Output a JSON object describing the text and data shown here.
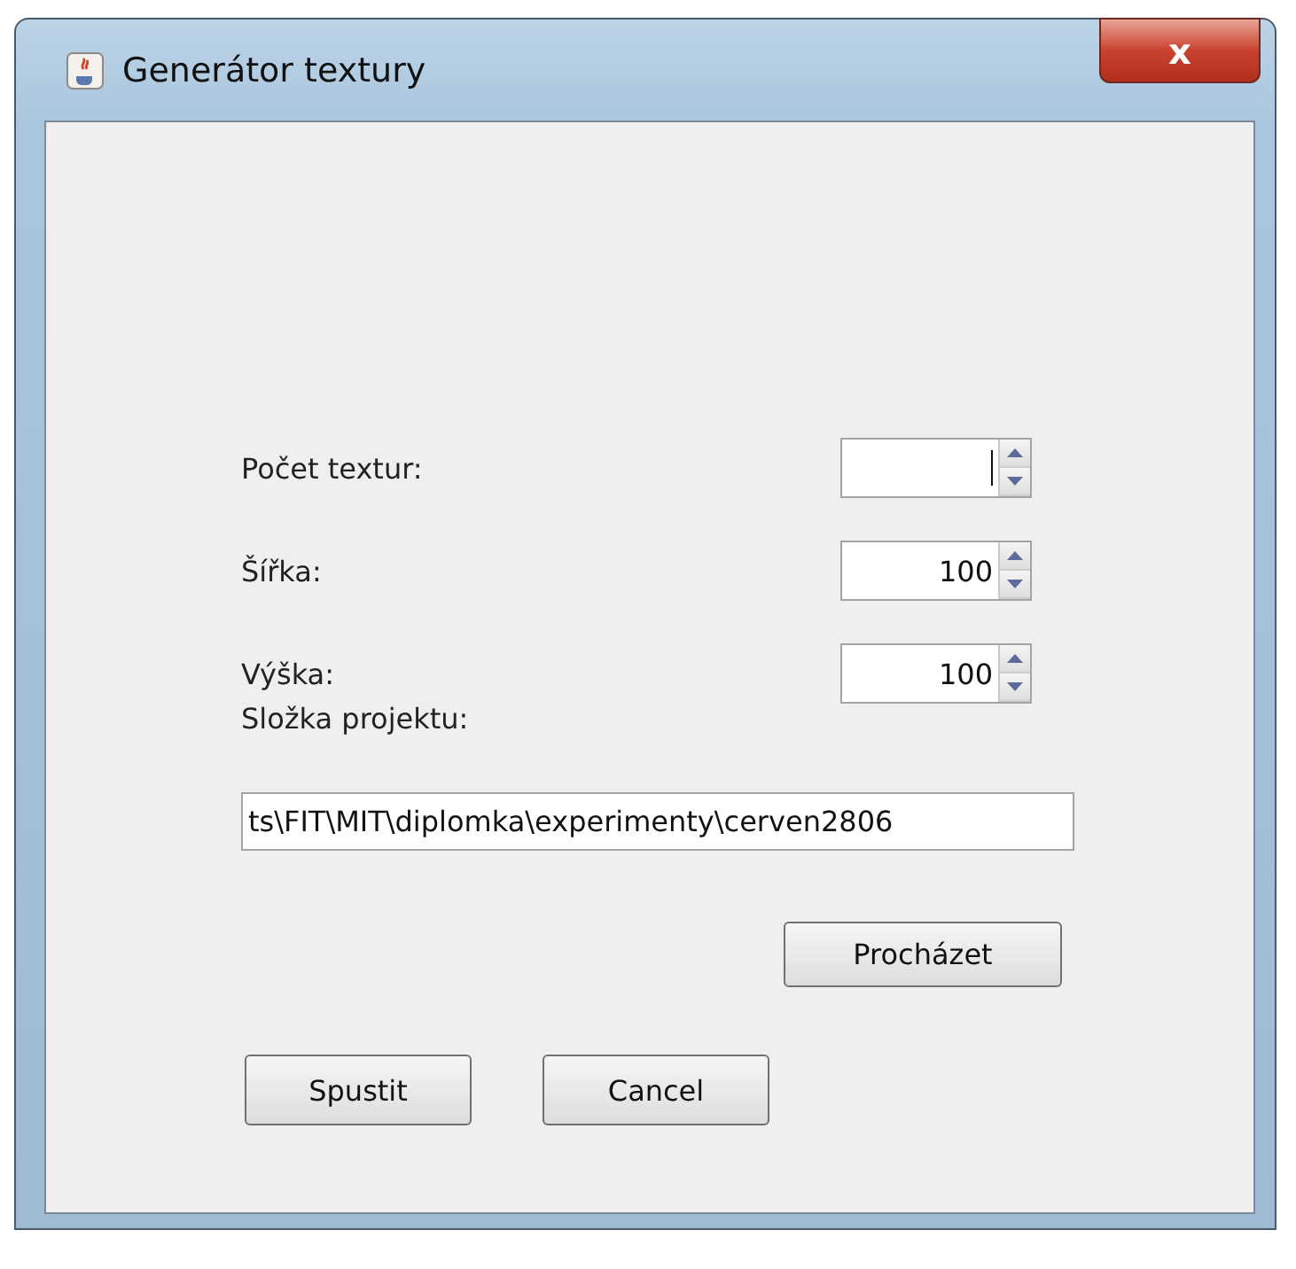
{
  "window": {
    "title": "Generátor textury",
    "close_symbol": "x"
  },
  "spinners": [
    {
      "label": "Počet textur:",
      "focused": true
    },
    {
      "label": "Šířka:",
      "value": "100",
      "focused": false
    },
    {
      "label": "Výška:",
      "value": "100",
      "focused": false
    }
  ],
  "folder": {
    "label": "Složka projektu:",
    "value": "ts\\FIT\\MIT\\diplomka\\experimenty\\cerven2806",
    "browse_button": "Procházet"
  },
  "buttons": [
    "Spustit",
    "Cancel"
  ]
}
